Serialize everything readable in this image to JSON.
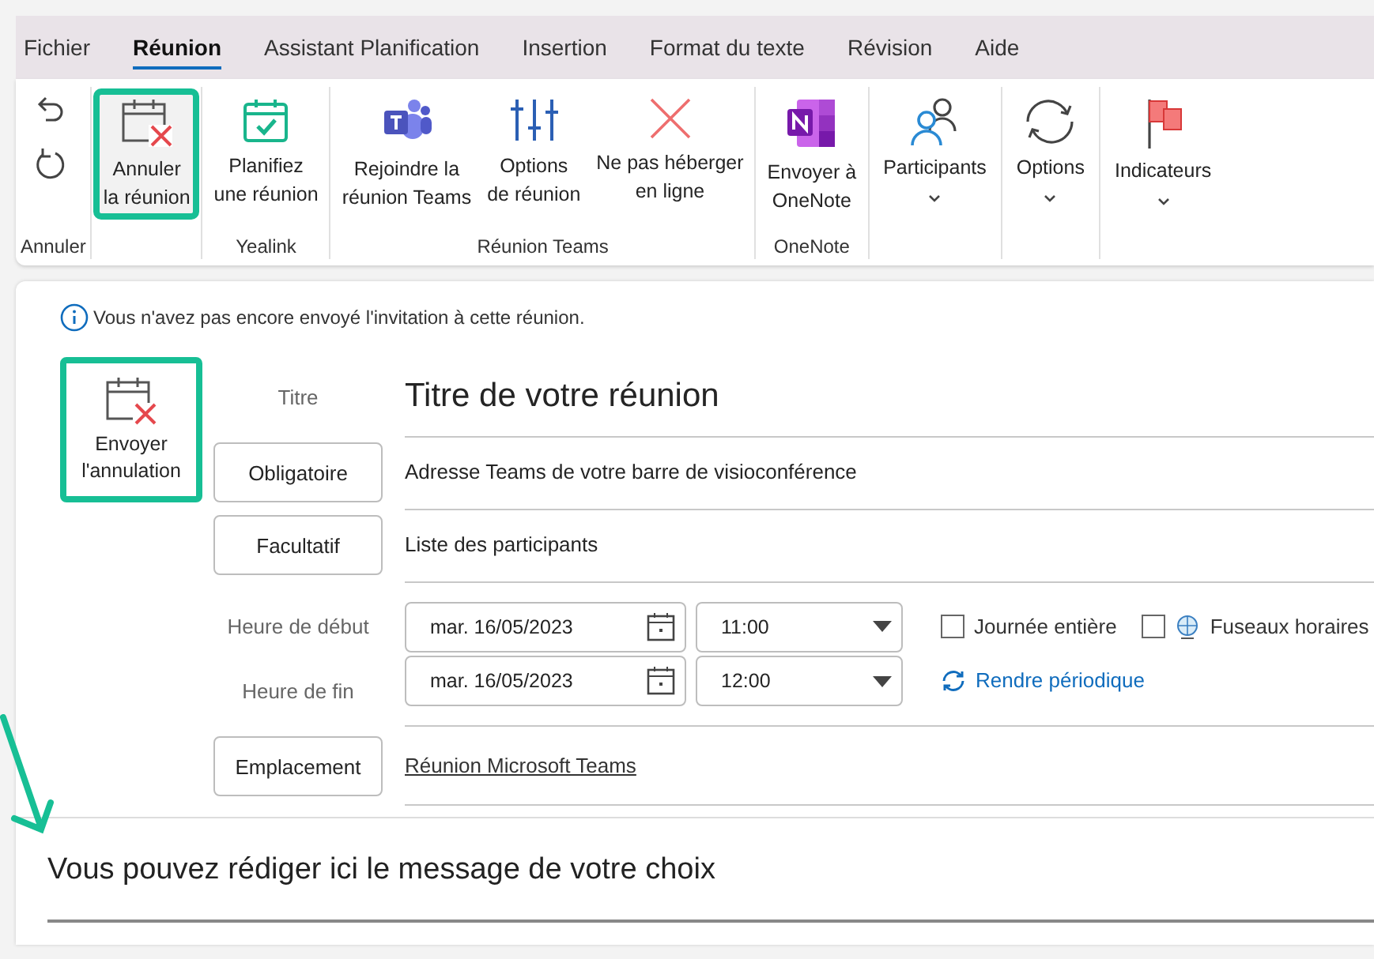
{
  "tabs": [
    {
      "label": "Fichier",
      "selected": false
    },
    {
      "label": "Réunion",
      "selected": true
    },
    {
      "label": "Assistant Planification",
      "selected": false
    },
    {
      "label": "Insertion",
      "selected": false
    },
    {
      "label": "Format du texte",
      "selected": false
    },
    {
      "label": "Révision",
      "selected": false
    },
    {
      "label": "Aide",
      "selected": false
    }
  ],
  "ribbon": {
    "groups": [
      {
        "label": "Annuler",
        "items": [
          {
            "kind": "small"
          },
          {
            "kind": "small"
          }
        ]
      },
      {
        "items": [
          {
            "kind": "large",
            "lines": [
              "Annuler",
              "la réunion"
            ],
            "highlighted": true
          }
        ]
      },
      {
        "label": "Yealink",
        "items": [
          {
            "kind": "large",
            "lines": [
              "Planifiez",
              "une réunion"
            ],
            "highlighted": false
          }
        ]
      },
      {
        "label": "Réunion Teams",
        "items": [
          {
            "kind": "large",
            "lines": [
              "Rejoindre la",
              "réunion Teams"
            ],
            "highlighted": false
          },
          {
            "kind": "large",
            "lines": [
              "Options",
              "de réunion"
            ],
            "highlighted": false
          },
          {
            "kind": "large",
            "lines": [
              "Ne pas héberger",
              "en ligne"
            ],
            "highlighted": false
          }
        ]
      },
      {
        "label": "OneNote",
        "items": [
          {
            "kind": "large",
            "lines": [
              "Envoyer à",
              "OneNote"
            ],
            "highlighted": false
          }
        ]
      },
      {
        "items": [
          {
            "kind": "menu",
            "lines": [
              "Participants"
            ]
          }
        ]
      },
      {
        "items": [
          {
            "kind": "menu",
            "lines": [
              "Options"
            ]
          }
        ]
      },
      {
        "items": [
          {
            "kind": "menu",
            "lines": [
              "Indicateurs"
            ]
          }
        ]
      }
    ]
  },
  "info": "Vous n'avez pas encore envoyé l'invitation à cette réunion.",
  "send_button": {
    "label": "Envoyer l'annulation",
    "highlighted": true
  },
  "title": {
    "label": "Titre",
    "value": "Titre de votre réunion"
  },
  "required": {
    "button": "Obligatoire",
    "value": "Adresse Teams de votre barre de visioconférence"
  },
  "optional": {
    "button": "Facultatif",
    "value": "Liste des participants"
  },
  "start": {
    "label": "Heure de début",
    "date": "mar. 16/05/2023",
    "time": "11:00"
  },
  "end": {
    "label": "Heure de fin",
    "date": "mar. 16/05/2023",
    "time": "12:00"
  },
  "all_day": {
    "label": "Journée entière",
    "checked": false
  },
  "time_zones": {
    "label": "Fuseaux horaires",
    "checked": false
  },
  "recurrence": "Rendre périodique",
  "location": {
    "button": "Emplacement",
    "value": "Réunion Microsoft Teams"
  },
  "body": "Vous pouvez rédiger ici le message de votre choix"
}
